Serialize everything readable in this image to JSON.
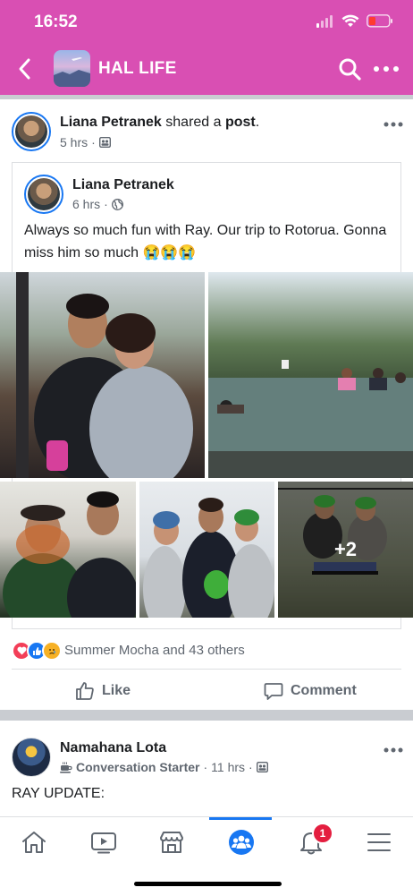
{
  "status_bar": {
    "time": "16:52"
  },
  "header": {
    "title": "HAL LIFE"
  },
  "post1": {
    "author": "Liana Petranek",
    "action_prefix": " shared a ",
    "action_object": "post",
    "action_suffix": ".",
    "time": "5 hrs",
    "shared": {
      "author": "Liana Petranek",
      "time": "6 hrs",
      "text": "Always so much fun with Ray. Our trip to Rotorua. Gonna miss him so much 😭😭😭"
    },
    "more_photos_label": "+2",
    "reactions_text": "Summer Mocha and 43 others",
    "like_label": "Like",
    "comment_label": "Comment"
  },
  "post2": {
    "author": "Namahana Lota",
    "badge": "Conversation Starter",
    "time": "11 hrs",
    "text": "RAY UPDATE:"
  },
  "tabbar": {
    "notifications_count": "1"
  },
  "colors": {
    "brand": "#d94fb3",
    "fb_blue": "#1877f2",
    "text_gray": "#606770"
  }
}
